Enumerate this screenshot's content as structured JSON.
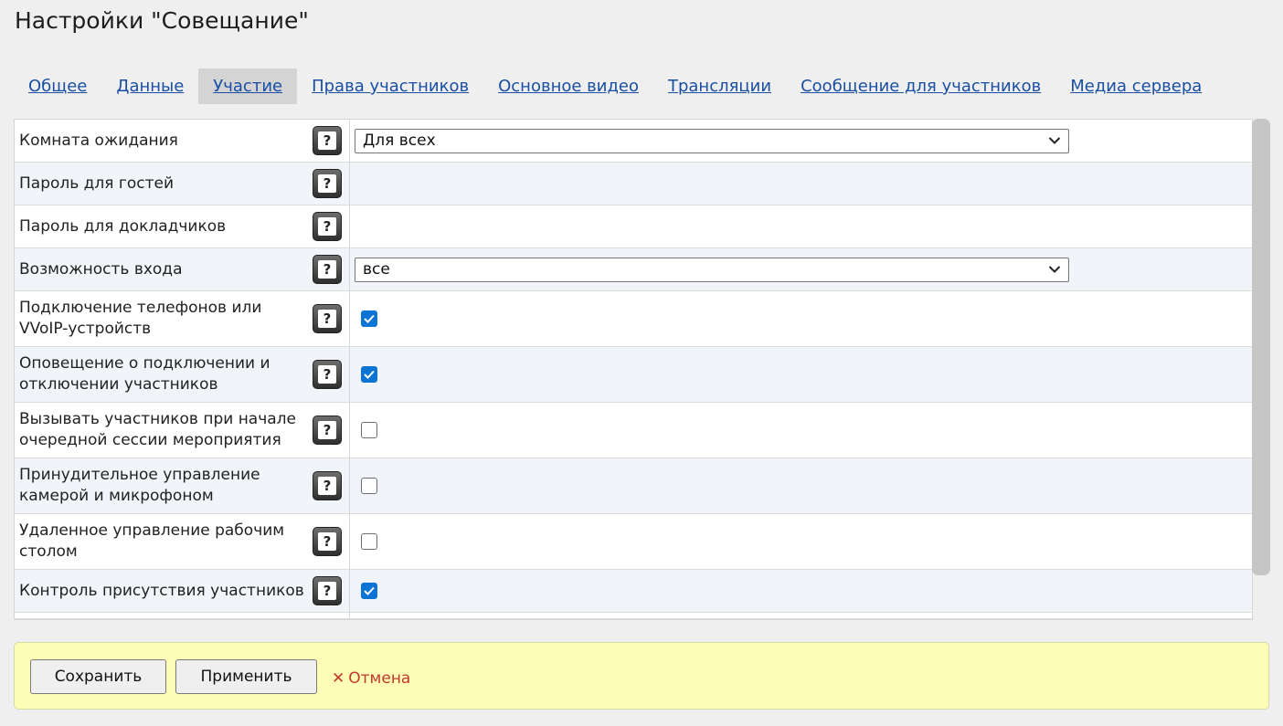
{
  "page": {
    "title": "Настройки \"Совещание\""
  },
  "tabs": [
    {
      "label": "Общее",
      "active": false
    },
    {
      "label": "Данные",
      "active": false
    },
    {
      "label": "Участие",
      "active": true
    },
    {
      "label": "Права участников",
      "active": false
    },
    {
      "label": "Основное видео",
      "active": false
    },
    {
      "label": "Трансляции",
      "active": false
    },
    {
      "label": "Сообщение для участников",
      "active": false
    },
    {
      "label": "Медиа сервера",
      "active": false
    }
  ],
  "settings": [
    {
      "label": "Комната ожидания",
      "type": "select",
      "value": "Для всех"
    },
    {
      "label": "Пароль для гостей",
      "type": "empty"
    },
    {
      "label": "Пароль для докладчиков",
      "type": "empty"
    },
    {
      "label": "Возможность входа",
      "type": "select",
      "value": "все"
    },
    {
      "label": "Подключение телефонов или VVoIP-устройств",
      "type": "checkbox",
      "checked": true
    },
    {
      "label": "Оповещение о подключении и отключении участников",
      "type": "checkbox",
      "checked": true
    },
    {
      "label": "Вызывать участников при начале очередной сессии мероприятия",
      "type": "checkbox",
      "checked": false
    },
    {
      "label": "Принудительное управление камерой и микрофоном",
      "type": "checkbox",
      "checked": false
    },
    {
      "label": "Удаленное управление рабочим столом",
      "type": "checkbox",
      "checked": false
    },
    {
      "label": "Контроль присутствия участников",
      "type": "checkbox",
      "checked": true
    }
  ],
  "help_icon": {
    "icon": "question-help-icon",
    "glyph": "?"
  },
  "footer": {
    "save_label": "Сохранить",
    "apply_label": "Применить",
    "cancel_label": "Отмена",
    "cancel_icon": "✕"
  },
  "colors": {
    "link": "#1a4fa3",
    "active_tab_bg": "#d4d4d4",
    "checkbox_on": "#0b74d4",
    "footer_bg": "#fdfdb8",
    "cancel": "#c0392b"
  }
}
